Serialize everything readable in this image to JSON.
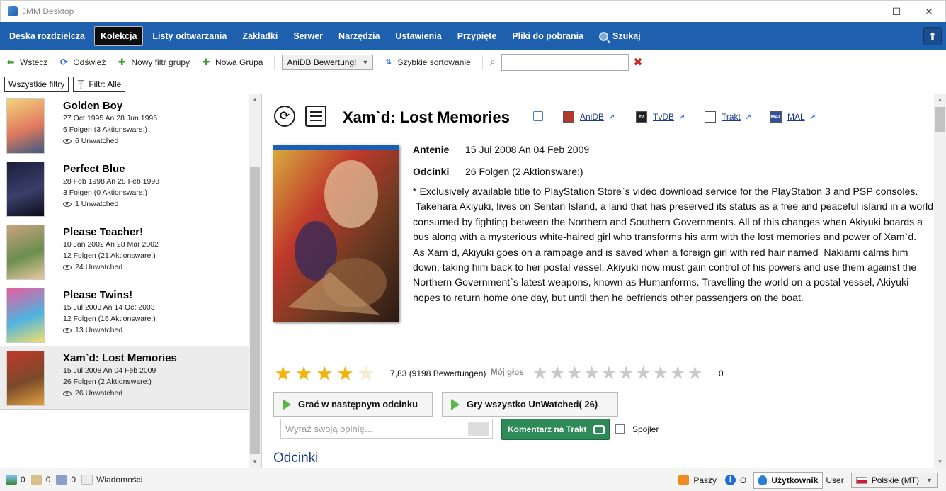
{
  "window": {
    "title": "JMM Desktop",
    "minimize": "—",
    "maximize": "☐",
    "close": "✕"
  },
  "nav": {
    "items": [
      "Deska rozdzielcza",
      "Kolekcja",
      "Listy odtwarzania",
      "Zakładki",
      "Serwer",
      "Narzędzia",
      "Ustawienia",
      "Przypięte",
      "Pliki do pobrania"
    ],
    "active_index": 1,
    "search_label": "Szukaj",
    "up_glyph": "⬆"
  },
  "toolbar": {
    "back": "Wstecz",
    "refresh": "Odśwież",
    "new_group_filter": "Nowy filtr grupy",
    "new_group": "Nowa Grupa",
    "sort_value": "AniDB Bewertung!",
    "quick_sort": "Szybkie sortowanie",
    "search_value": "",
    "clear_glyph": "✖"
  },
  "filterbar": {
    "all_filters": "Wszystkie filtry",
    "filter": "Filtr: Alle"
  },
  "series_list": [
    {
      "title": "Golden Boy",
      "dates": "27 Oct 1995  An  28 Jun 1996",
      "episodes": "6 Folgen (3 Aktionsware:)",
      "unwatched": "6  Unwatched",
      "thumb_colors": [
        "#f3d27a",
        "#e07a5f",
        "#3d5a80"
      ]
    },
    {
      "title": "Perfect Blue",
      "dates": "28 Feb 1998  An  28 Feb 1998",
      "episodes": "3 Folgen (0 Aktionsware:)",
      "unwatched": "1  Unwatched",
      "thumb_colors": [
        "#1b1f3a",
        "#3a3f6b",
        "#0c0c18"
      ]
    },
    {
      "title": "Please Teacher!",
      "dates": "10 Jan 2002  An  28 Mar 2002",
      "episodes": "12 Folgen (21 Aktionsware:)",
      "unwatched": "24  Unwatched",
      "thumb_colors": [
        "#c9a27e",
        "#6b8e4e",
        "#e8c9a0"
      ]
    },
    {
      "title": "Please Twins!",
      "dates": "15 Jul 2003  An  14 Oct 2003",
      "episodes": "12 Folgen (16 Aktionsware:)",
      "unwatched": "13  Unwatched",
      "thumb_colors": [
        "#e85d9e",
        "#4fb3e0",
        "#f2e06b"
      ]
    },
    {
      "title": "Xam`d: Lost Memories",
      "dates": "15 Jul 2008  An  04 Feb 2009",
      "episodes": "26 Folgen (2 Aktionsware:)",
      "unwatched": "26  Unwatched",
      "thumb_colors": [
        "#c0392b",
        "#7a4a2a",
        "#e0a040"
      ]
    }
  ],
  "selected_series_index": 4,
  "detail": {
    "title": "Xam`d: Lost Memories",
    "links": [
      {
        "label": "AniDB",
        "logo": ""
      },
      {
        "label": "TvDB",
        "logo": "tv"
      },
      {
        "label": "Trakt",
        "logo": ""
      },
      {
        "label": "MAL",
        "logo": "MAL"
      }
    ],
    "aired_label": "Antenie",
    "aired_value": "15 Jul 2008  An  04 Feb 2009",
    "episodes_label": "Odcinki",
    "episodes_value": "26 Folgen (2 Aktionsware:)",
    "description": "* Exclusively available title to PlayStation Store`s video download service for the PlayStation 3 and PSP consoles.\n Takehara Akiyuki, lives on Sentan Island, a land that has preserved its status as a free and peaceful island in a world consumed by fighting between the Northern and Southern Governments. All of this changes when Akiyuki boards a bus along with a mysterious white-haired girl who transforms his arm with the lost memories and power of Xam`d.\nAs Xam`d, Akiyuki goes on a rampage and is saved when a foreign girl with red hair named  Nakiami calms him down, taking him back to her postal vessel. Akiyuki now must gain control of his powers and use them against the Northern Government`s latest weapons, known as Humanforms. Travelling the world on a postal vessel, Akiyuki hopes to return home one day, but until then he befriends other passengers on the boat.",
    "rating_stars_filled": 4,
    "rating_stars_total": 5,
    "rating_text": "7,83 (9198 Bewertungen)",
    "my_vote_label": "Mój głos",
    "my_vote_stars_total": 10,
    "my_vote_value": "0",
    "play_next": "Grać w następnym odcinku",
    "play_all": "Gry wszystko UnWatched(  26)",
    "comment_placeholder": "Wyraź swoją opinię...",
    "comment_button": "Komentarz na Trakt",
    "spoiler_label": "Spojler",
    "episodes_heading": "Odcinki"
  },
  "statusbar": {
    "count1": "0",
    "count2": "0",
    "count3": "0",
    "messages": "Wiadomości",
    "rss": "Paszy",
    "info": "O",
    "user_button": "Użytkownik",
    "user_name": "User",
    "language": "Polskie (MT)"
  },
  "colors": {
    "nav_bg": "#1e5fae",
    "trakt_green": "#2e8b57",
    "star_gold": "#f5b400",
    "link_blue": "#1a3c8a"
  }
}
